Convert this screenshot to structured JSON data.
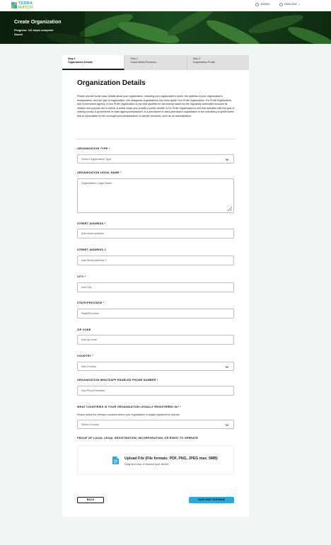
{
  "header": {
    "logo_line1": "TERRA",
    "logo_line2": "MATCH",
    "notifications_label": "100000",
    "language_label": "ENGLISH"
  },
  "hero": {
    "title": "Create Organization",
    "progress": "Progress: 1/3 steps complete",
    "status": "Saved"
  },
  "steps": [
    {
      "number": "Step 1",
      "name": "Organization Details"
    },
    {
      "number": "Step 2",
      "name": "Social Media Presence"
    },
    {
      "number": "Step 3",
      "name": "Organization Profile"
    }
  ],
  "form": {
    "title": "Organization Details",
    "intro": "Please provide some basic details about your organization, including your organization's name, the address of your organization's headquarters, and the type of organization. We categorize organizations into three types: Non Profit Organization, For Profit Organization, and Government Agency. A Non Profit Organization is one that qualifies for tax-exempt status by the regulatory authorities because its mission and purpose are to further a social cause and provide a public benefit. A For Profit Organization is one that operates with the goal of making money. A government or state agency/commission, is a permanent or semi-permanent organization in the machinery of government that is responsible for the oversight and administration of specific functions, such as an administration.",
    "fields": {
      "org_type": {
        "label": "ORGANIZATION TYPE *",
        "value": "Select Organization Type"
      },
      "legal_name": {
        "label": "ORGANIZATION LEGAL NAME *",
        "placeholder": "Organization Legal Name"
      },
      "street1": {
        "label": "STREET ADDRESS *",
        "placeholder": "Add street address"
      },
      "street2": {
        "label": "STREET ADDRESS 2",
        "placeholder": "Add Street address 2"
      },
      "city": {
        "label": "CITY *",
        "placeholder": "Add City"
      },
      "state": {
        "label": "STATE/PROVINCE *",
        "placeholder": "State/Province"
      },
      "zip": {
        "label": "ZIP CODE",
        "placeholder": "Add zip code"
      },
      "country": {
        "label": "COUNTRY *",
        "value": "Add Country"
      },
      "phone": {
        "label": "ORGANIZATION WHATSAPP ENABLED PHONE NUMBER *",
        "placeholder": "Add Phone Number"
      },
      "registered_countries": {
        "label": "WHAT COUNTRIES IS YOUR ORGANIZATION LEGALLY REGISTERED IN? *",
        "help": "Please select the relevant countries where your organization is legally registered to operate.",
        "value": "Select Country"
      },
      "proof": {
        "label": "PROOF OF LOCAL LEGAL REGISTRATION, INCORPORATION, OR RIGHT TO OPERATE",
        "upload_title": "Upload File (File formats: PDF, PNG, JPEG max. 5MB)",
        "upload_sub": "Drag and drop or browse your device"
      }
    },
    "back_label": "BACK",
    "save_label": "SAVE AND CONTINUE"
  },
  "colors": {
    "accent": "#27a9e1",
    "brand_green": "#8cc540",
    "hero_bg": "#0f2a12"
  }
}
